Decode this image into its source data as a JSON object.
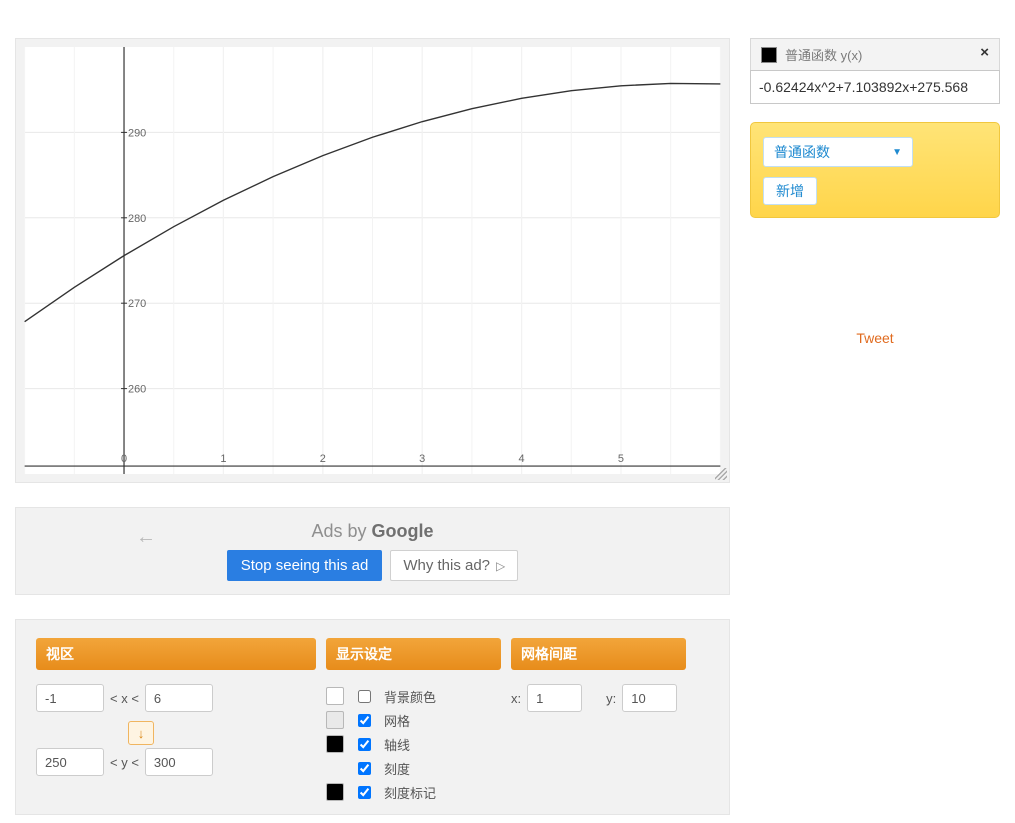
{
  "chart_data": {
    "type": "line",
    "title": "",
    "xlabel": "",
    "ylabel": "",
    "xlim": [
      -1,
      6
    ],
    "ylim": [
      250,
      300
    ],
    "xticks": [
      0,
      1,
      2,
      3,
      4,
      5
    ],
    "yticks": [
      260,
      270,
      280,
      290
    ],
    "grid": true,
    "series": [
      {
        "name": "-0.62424x^2+7.103892x+275.568",
        "expr": "-0.62424*x*x + 7.103892*x + 275.568",
        "x": [
          -1,
          -0.5,
          0,
          0.5,
          1,
          1.5,
          2,
          2.5,
          3,
          3.5,
          4,
          4.5,
          5,
          5.5,
          6
        ],
        "y": [
          267.84,
          271.86,
          275.57,
          278.96,
          282.05,
          284.82,
          287.28,
          289.43,
          291.26,
          292.78,
          293.99,
          294.88,
          295.46,
          295.73,
          295.68
        ]
      }
    ]
  },
  "ads": {
    "title_prefix": "Ads by ",
    "google": "Google",
    "stop": "Stop seeing this ad",
    "why": "Why this ad?"
  },
  "settings": {
    "view": {
      "header": "视区",
      "xmin": "-1",
      "xmax": "6",
      "ymin": "250",
      "ymax": "300",
      "xlabel": "< x <",
      "ylabel": "< y <"
    },
    "display": {
      "header": "显示设定",
      "items": [
        {
          "label": "背景颜色",
          "checked": false,
          "swatch": "sw-white"
        },
        {
          "label": "网格",
          "checked": true,
          "swatch": "sw-lgrey"
        },
        {
          "label": "轴线",
          "checked": true,
          "swatch": "sw-black"
        },
        {
          "label": "刻度",
          "checked": true,
          "swatch": ""
        },
        {
          "label": "刻度标记",
          "checked": true,
          "swatch": "sw-black"
        }
      ]
    },
    "grid": {
      "header": "网格间距",
      "xlabel": "x:",
      "ylabel": "y:",
      "xval": "1",
      "yval": "10"
    }
  },
  "sidebar": {
    "fn_title": "普通函数 y(x)",
    "fn_value": "-0.62424x^2+7.103892x+275.568",
    "select_label": "普通函数",
    "add_label": "新增"
  },
  "tweet": "Tweet"
}
